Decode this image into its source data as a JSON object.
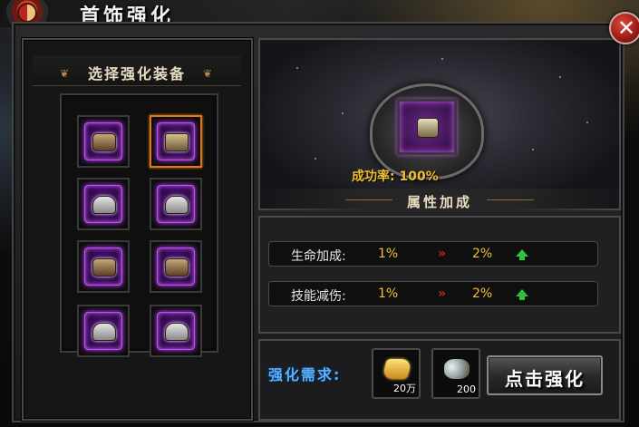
{
  "window": {
    "title": "首饰强化",
    "close_label": "✕"
  },
  "equipment_panel": {
    "title": "选择强化装备",
    "slots": [
      {
        "icon": "bracelet-icon",
        "selected": false
      },
      {
        "icon": "ring-icon",
        "selected": true
      },
      {
        "icon": "helmet-icon",
        "selected": false
      },
      {
        "icon": "helmet-icon",
        "selected": false
      },
      {
        "icon": "bracelet-icon",
        "selected": false
      },
      {
        "icon": "bracelet-icon",
        "selected": false
      },
      {
        "icon": "boots-icon",
        "selected": false
      },
      {
        "icon": "boots-icon",
        "selected": false
      }
    ]
  },
  "preview": {
    "icon": "ring-icon",
    "success_rate": "成功率: 100%"
  },
  "attributes": {
    "title": "属性加成",
    "rows": [
      {
        "name": "生命加成:",
        "current": "1%",
        "arrow": "»",
        "next": "2%",
        "trend": "up-arrow-icon"
      },
      {
        "name": "技能减伤:",
        "current": "1%",
        "arrow": "»",
        "next": "2%",
        "trend": "up-arrow-icon"
      }
    ]
  },
  "requirements": {
    "label": "强化需求:",
    "costs": [
      {
        "icon": "gold-ingot-icon",
        "amount": "20万"
      },
      {
        "icon": "ore-icon",
        "amount": "200"
      }
    ],
    "button_label": "点击强化"
  },
  "colors": {
    "accent_gold": "#f0c030",
    "select_orange": "#e07818",
    "req_blue": "#5ab0ff",
    "up_green": "#2ec43a"
  }
}
